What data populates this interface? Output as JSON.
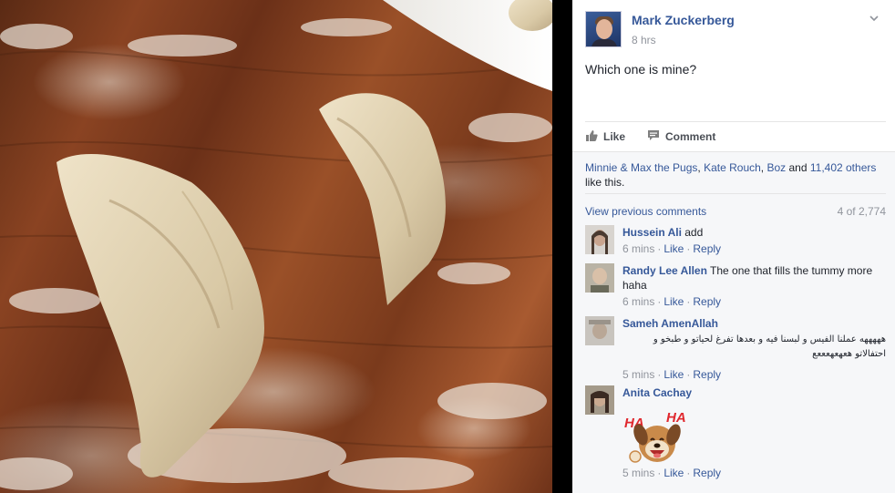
{
  "post": {
    "author": "Mark Zuckerberg",
    "time": "8 hrs",
    "text": "Which one is mine?",
    "menu_icon": "chevron-down-icon"
  },
  "actions": {
    "like_label": "Like",
    "comment_label": "Comment",
    "like_icon": "thumbs-up-icon",
    "comment_icon": "speech-bubble-icon"
  },
  "likes": {
    "names": [
      "Minnie & Max the Pugs",
      "Kate Rouch",
      "Boz"
    ],
    "sep1": ", ",
    "sep2": ", ",
    "and": " and ",
    "others": "11,402 others",
    "suffix": " like this."
  },
  "comments_header": {
    "view_previous": "View previous comments",
    "count": "4 of 2,774"
  },
  "comments": [
    {
      "name": "Hussein Ali",
      "text": "add",
      "time": "6 mins",
      "like": "Like",
      "reply": "Reply"
    },
    {
      "name": "Randy Lee Allen",
      "text": "The one that fills the tummy more haha",
      "time": "6 mins",
      "like": "Like",
      "reply": "Reply"
    },
    {
      "name": "Sameh AmenAllah",
      "text": "هههههه عملنا الفيس و لبسنا فيه و بعدها تفرغ لحياتو و طبخو و احتفالاتو هعهعهعععع",
      "time": "5 mins",
      "like": "Like",
      "reply": "Reply"
    },
    {
      "name": "Anita Cachay",
      "text": "",
      "sticker": "haha-dog-sticker",
      "time": "5 mins",
      "like": "Like",
      "reply": "Reply"
    }
  ],
  "sticker_text": {
    "left": "HA",
    "right": "HA"
  },
  "colors": {
    "link": "#365899",
    "meta": "#90949c",
    "sticker_text": "#e0282e"
  }
}
